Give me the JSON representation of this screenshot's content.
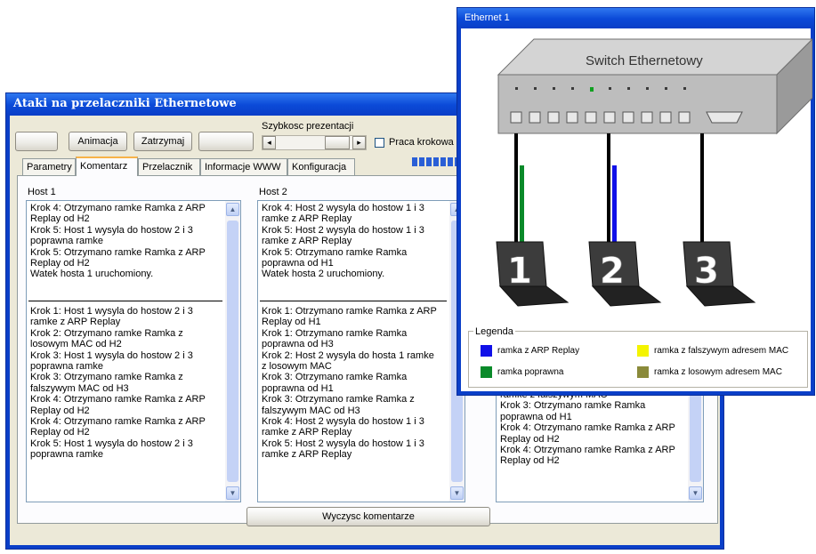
{
  "main_window": {
    "title": "Ataki na przelaczniki Ethernetowe",
    "buttons": {
      "b1": "",
      "animate": "Animacja",
      "stop": "Zatrzymaj",
      "b4": ""
    },
    "speed_label": "Szybkosc prezentacji",
    "checkbox_label": "Praca krokowa",
    "tabs": [
      "Parametry",
      "Komentarz",
      "Przelacznik",
      "Informacje WWW",
      "Konfiguracja"
    ],
    "active_tab": "Komentarz",
    "host1": {
      "label": "Host 1",
      "top_text": "Krok 4: Otrzymano ramke Ramka z ARP\nReplay od H2\nKrok 5: Host 1 wysyla do hostow 2 i 3\npoprawna ramke\nKrok 5: Otrzymano ramke Ramka z ARP\nReplay od H2\nWatek hosta 1 uruchomiony.",
      "bottom_text": "Krok 1: Host 1 wysyla do hostow 2 i 3\nramke z ARP Replay\nKrok 2: Otrzymano ramke Ramka z\nlosowym MAC od H2\nKrok 3: Host 1 wysyla do hostow 2 i 3\npoprawna ramke\nKrok 3: Otrzymano ramke Ramka z\nfalszywym MAC od H3\nKrok 4: Otrzymano ramke Ramka z ARP\nReplay od H2\nKrok 4: Otrzymano ramke Ramka z ARP\nReplay od H2\nKrok 5: Host 1 wysyla do hostow 2 i 3\npoprawna ramke"
    },
    "host2": {
      "label": "Host 2",
      "top_text": "Krok 4: Host 2 wysyla do hostow 1 i 3\nramke z ARP Replay\nKrok 5: Host 2 wysyla do hostow 1 i 3\nramke z ARP Replay\nKrok 5: Otrzymano ramke Ramka\npoprawna od H1\nWatek hosta 2 uruchomiony.",
      "bottom_text": "Krok 1: Otrzymano ramke Ramka z ARP\nReplay od H1\nKrok 1: Otrzymano ramke Ramka\npoprawna od H3\nKrok 2: Host 2 wysyla do hosta 1 ramke\nz losowym MAC\nKrok 3: Otrzymano ramke Ramka\npoprawna od H1\nKrok 3: Otrzymano ramke Ramka z\nfalszywym MAC od H3\nKrok 4: Host 2 wysyla do hostow 1 i 3\nramke z ARP Replay\nKrok 5: Host 2 wysyla do hostow 1 i 3\nramke z ARP Replay"
    },
    "host3": {
      "bottom_text": "ramke z falszywym MAC\nKrok 3: Otrzymano ramke Ramka\npoprawna od H1\nKrok 4: Otrzymano ramke Ramka z ARP\nReplay od H2\nKrok 4: Otrzymano ramke Ramka z ARP\nReplay od H2"
    },
    "clear_button": "Wyczysc komentarze"
  },
  "switch_window": {
    "title": "Ethernet 1",
    "switch_label": "Switch Ethernetowy",
    "hosts": [
      "1",
      "2",
      "3"
    ],
    "legend": {
      "title": "Legenda",
      "items": [
        {
          "label": "ramka z ARP Replay",
          "color": "#1010e8"
        },
        {
          "label": "ramka z falszywym adresem MAC",
          "color": "#f4f400"
        },
        {
          "label": "ramka poprawna",
          "color": "#0a8a2a"
        },
        {
          "label": "ramka z losowym adresem MAC",
          "color": "#8a8a3a"
        }
      ]
    }
  }
}
